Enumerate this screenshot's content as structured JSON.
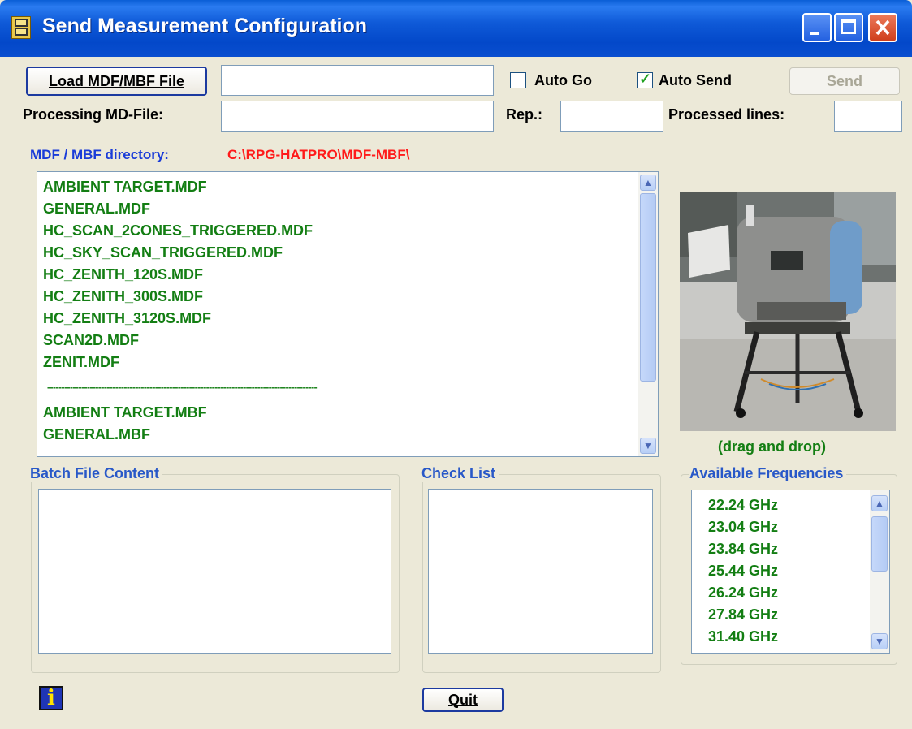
{
  "window": {
    "title": "Send Measurement Configuration",
    "app_icon": "rpg-logo-icon",
    "controls": [
      "minimize",
      "maximize",
      "close"
    ]
  },
  "toolbar": {
    "load_button_label": "Load MDF/MBF File",
    "load_file_value": "",
    "auto_go_label": "Auto Go",
    "auto_go_checked": false,
    "auto_send_label": "Auto Send",
    "auto_send_checked": true,
    "send_button_label": "Send",
    "processing_label": "Processing MD-File:",
    "processing_value": "",
    "rep_label": "Rep.:",
    "rep_value": "",
    "processed_lines_label": "Processed lines:",
    "processed_lines_value": ""
  },
  "directory": {
    "label": "MDF / MBF directory:",
    "path": "C:\\RPG-HATPRO\\MDF-MBF\\"
  },
  "file_list": {
    "items": [
      "AMBIENT TARGET.MDF",
      "GENERAL.MDF",
      "HC_SCAN_2CONES_TRIGGERED.MDF",
      "HC_SKY_SCAN_TRIGGERED.MDF",
      "HC_ZENITH_120S.MDF",
      "HC_ZENITH_300S.MDF",
      "HC_ZENITH_3120S.MDF",
      "SCAN2D.MDF",
      "ZENIT.MDF",
      "-----------------------------------------------------------------------------------------------",
      "AMBIENT TARGET.MBF",
      "GENERAL.MBF"
    ]
  },
  "image_panel": {
    "caption": "(drag and drop)"
  },
  "groups": {
    "batch_title": "Batch File Content",
    "check_title": "Check List",
    "freq_title": "Available Frequencies"
  },
  "frequencies": [
    "22.24 GHz",
    "23.04 GHz",
    "23.84 GHz",
    "25.44 GHz",
    "26.24 GHz",
    "27.84 GHz",
    "31.40 GHz"
  ],
  "footer": {
    "info_icon": "info-icon",
    "quit_label": "Quit"
  },
  "colors": {
    "titlebar": "#0a4fd0",
    "list_text": "#137e13",
    "directory_label": "#1a3cd8",
    "directory_path": "#ff1a1a",
    "group_title": "#2858c8"
  }
}
